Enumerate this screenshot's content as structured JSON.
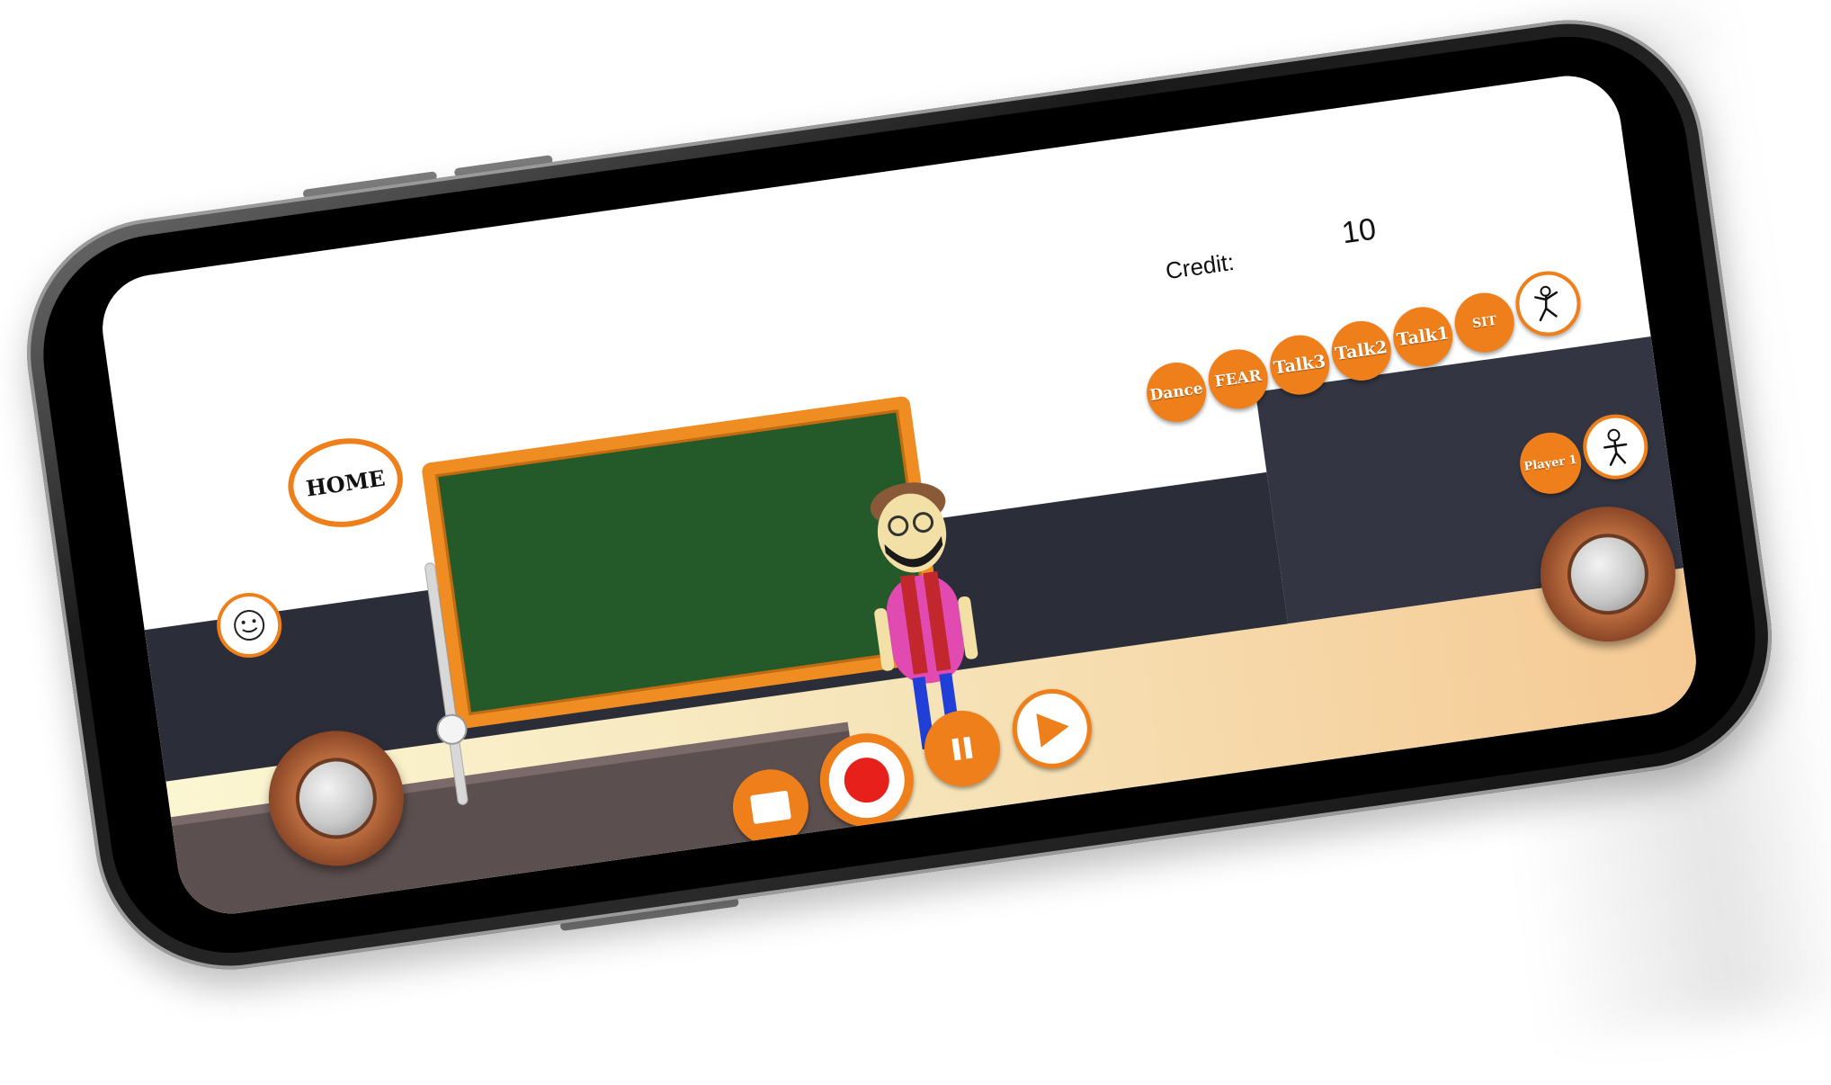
{
  "hud": {
    "home_label": "HOME",
    "credit_label": "Credit:",
    "credit_value": "10"
  },
  "actions": [
    {
      "label": "Dance"
    },
    {
      "label": "FEAR"
    },
    {
      "label": "Talk3"
    },
    {
      "label": "Talk2"
    },
    {
      "label": "Talk1"
    },
    {
      "label": "SIT"
    }
  ],
  "player": {
    "label": "Player 1"
  },
  "icons": {
    "face": "smiley-face-icon",
    "pose": "dancing-stick-figure-icon",
    "player": "stick-figure-icon",
    "stop": "stop-icon",
    "record": "record-icon",
    "pause": "pause-icon",
    "play": "play-icon"
  },
  "colors": {
    "accent": "#ef7f1a",
    "board": "#245a2a",
    "record": "#e8201c"
  }
}
